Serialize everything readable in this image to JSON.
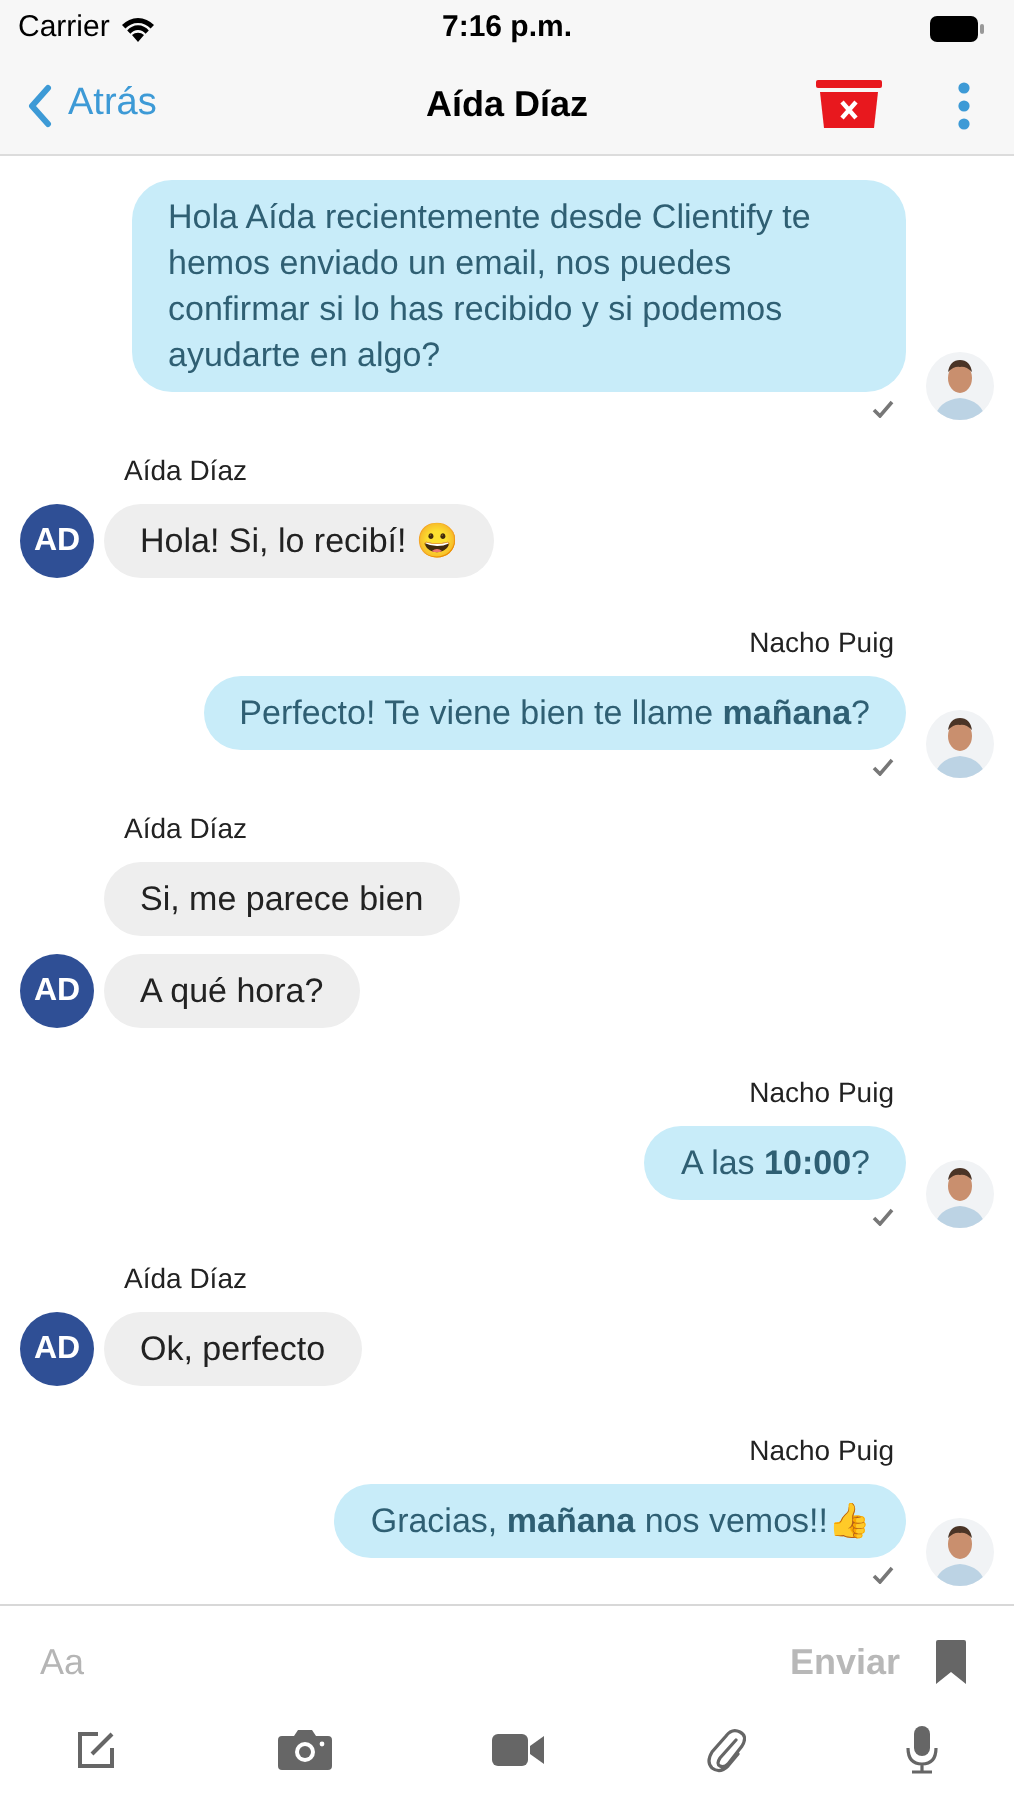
{
  "status_bar": {
    "carrier": "Carrier",
    "time": "7:16 p.m."
  },
  "nav": {
    "back": "Atrás",
    "title": "Aída Díaz"
  },
  "messages": [
    {
      "kind": "outgoing",
      "text": "Hola Aída recientemente desde Clientify te hemos enviado un email, nos puedes confirmar si lo has recibido y si podemos ayudarte en algo?"
    },
    {
      "kind": "incoming_sender",
      "text": "Aída Díaz"
    },
    {
      "kind": "incoming",
      "text": "Hola! Si, lo recibí! 😀",
      "avatar": "AD"
    },
    {
      "kind": "outgoing_sender",
      "text": "Nacho Puig"
    },
    {
      "kind": "outgoing",
      "text": "Perfecto! Te viene bien te llame **mañana**?"
    },
    {
      "kind": "incoming_sender",
      "text": "Aída Díaz"
    },
    {
      "kind": "incoming",
      "text": "Si, me parece bien"
    },
    {
      "kind": "incoming",
      "text": "A qué hora?",
      "avatar": "AD"
    },
    {
      "kind": "outgoing_sender",
      "text": "Nacho Puig"
    },
    {
      "kind": "outgoing",
      "text": "A las **10:00**?"
    },
    {
      "kind": "incoming_sender",
      "text": "Aída Díaz"
    },
    {
      "kind": "incoming",
      "text": "Ok, perfecto",
      "avatar": "AD"
    },
    {
      "kind": "outgoing_sender",
      "text": "Nacho Puig"
    },
    {
      "kind": "outgoing",
      "text": "Gracias, **mañana** nos vemos!!👍"
    }
  ],
  "composer": {
    "placeholder": "Aa",
    "send": "Enviar",
    "send_disabled": true
  }
}
